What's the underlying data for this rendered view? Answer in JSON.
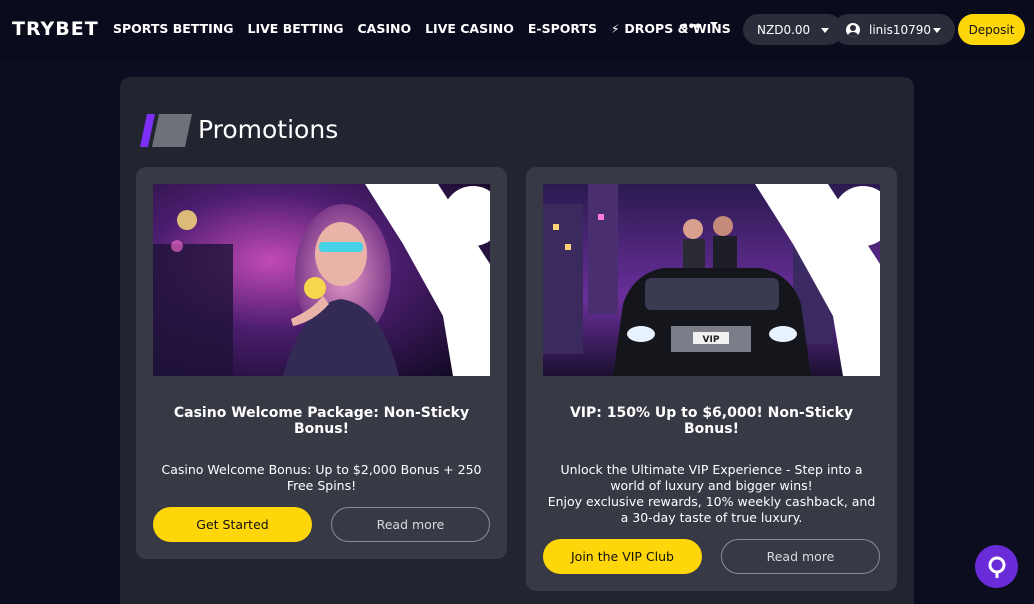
{
  "header": {
    "logo": "TRYBET",
    "nav": [
      {
        "label": "SPORTS BETTING"
      },
      {
        "label": "LIVE BETTING"
      },
      {
        "label": "CASINO"
      },
      {
        "label": "LIVE CASINO"
      },
      {
        "label": "E-SPORTS"
      },
      {
        "label": "DROPS & WINS",
        "icon": "lightning-icon"
      }
    ],
    "more_label": "•••",
    "balance": "NZD0.00",
    "username": "linis10790",
    "deposit_label": "Deposit"
  },
  "page": {
    "title": "Promotions"
  },
  "promotions": [
    {
      "title": "Casino Welcome Package: Non-Sticky Bonus!",
      "description": "Casino Welcome Bonus: Up to $2,000 Bonus + 250 Free Spins!",
      "primary_label": "Get Started",
      "secondary_label": "Read more"
    },
    {
      "title": "VIP: 150% Up to $6,000! Non-Sticky Bonus!",
      "description_line1": "Unlock the Ultimate VIP Experience - Step into a world of luxury and bigger wins!",
      "description_line2": "Enjoy exclusive rewards, 10% weekly cashback, and a 30-day taste of true luxury.",
      "primary_label": "Join the VIP Club",
      "secondary_label": "Read more",
      "image_plate_text": "VIP"
    }
  ],
  "colors": {
    "background": "#0c0d1f",
    "accent_yellow": "#ffd60a",
    "accent_purple": "#6a2bd9",
    "card": "#373944",
    "panel": "#22242f"
  }
}
